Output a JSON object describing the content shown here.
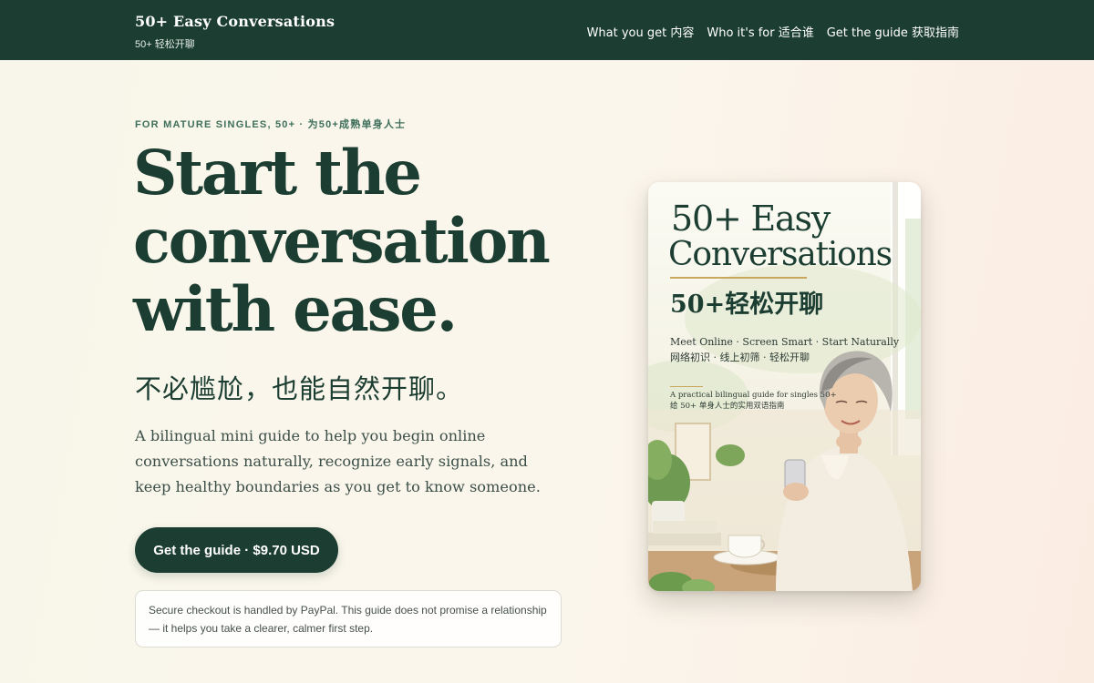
{
  "header": {
    "brand_title": "50+ Easy Conversations",
    "brand_subtitle": "50+ 轻松开聊",
    "nav": [
      {
        "label": "What you get 内容"
      },
      {
        "label": "Who it's for 适合谁"
      },
      {
        "label": "Get the guide 获取指南"
      }
    ]
  },
  "hero": {
    "eyebrow": "FOR MATURE SINGLES, 50+ · 为50+成熟单身人士",
    "headline_lines": [
      "Start the",
      "conversation",
      "with ease."
    ],
    "subhead_zh": "不必尴尬，也能自然开聊。",
    "lead": "A bilingual mini guide to help you begin online conversations naturally, recognize early signals, and keep healthy boundaries as you get to know someone.",
    "cta_label": "Get the guide · $9.70 USD",
    "note": "Secure checkout is handled by PayPal. This guide does not promise a relationship — it helps you take a clearer, calmer first step."
  },
  "cover": {
    "title_line1": "50+ Easy",
    "title_line2": "Conversations",
    "title_zh": "50+轻松开聊",
    "tagline": "Meet Online · Screen Smart · Start Naturally",
    "tagline_zh": "网络初识 · 线上初筛 · 轻松开聊",
    "small": "A practical bilingual guide for singles 50+",
    "small_zh": "给 50+ 单身人士的实用双语指南"
  },
  "colors": {
    "header_bg": "#1c3d31",
    "accent_green": "#1c3d31",
    "eyebrow_green": "#3f6f5b",
    "gold_rule": "#c9a85e"
  }
}
